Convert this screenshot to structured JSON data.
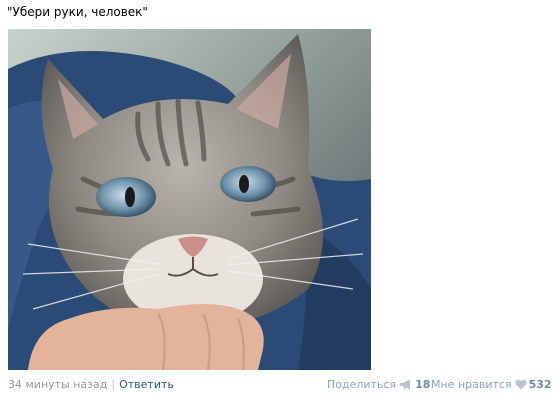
{
  "post": {
    "text": "\"Убери руки, человек\""
  },
  "photo": {
    "subject": "cat-photo"
  },
  "footer": {
    "time": "34 минуты назад",
    "separator": "|",
    "reply_label": "Ответить",
    "share_label": "Поделиться",
    "share_count": "18",
    "like_label": "Мне нравится",
    "like_count": "532"
  },
  "icons": {
    "share": "megaphone-icon",
    "like": "heart-icon"
  },
  "colors": {
    "link": "#2b587a",
    "muted": "#999999",
    "action": "#8ea3b8",
    "count": "#6f8aa5"
  }
}
